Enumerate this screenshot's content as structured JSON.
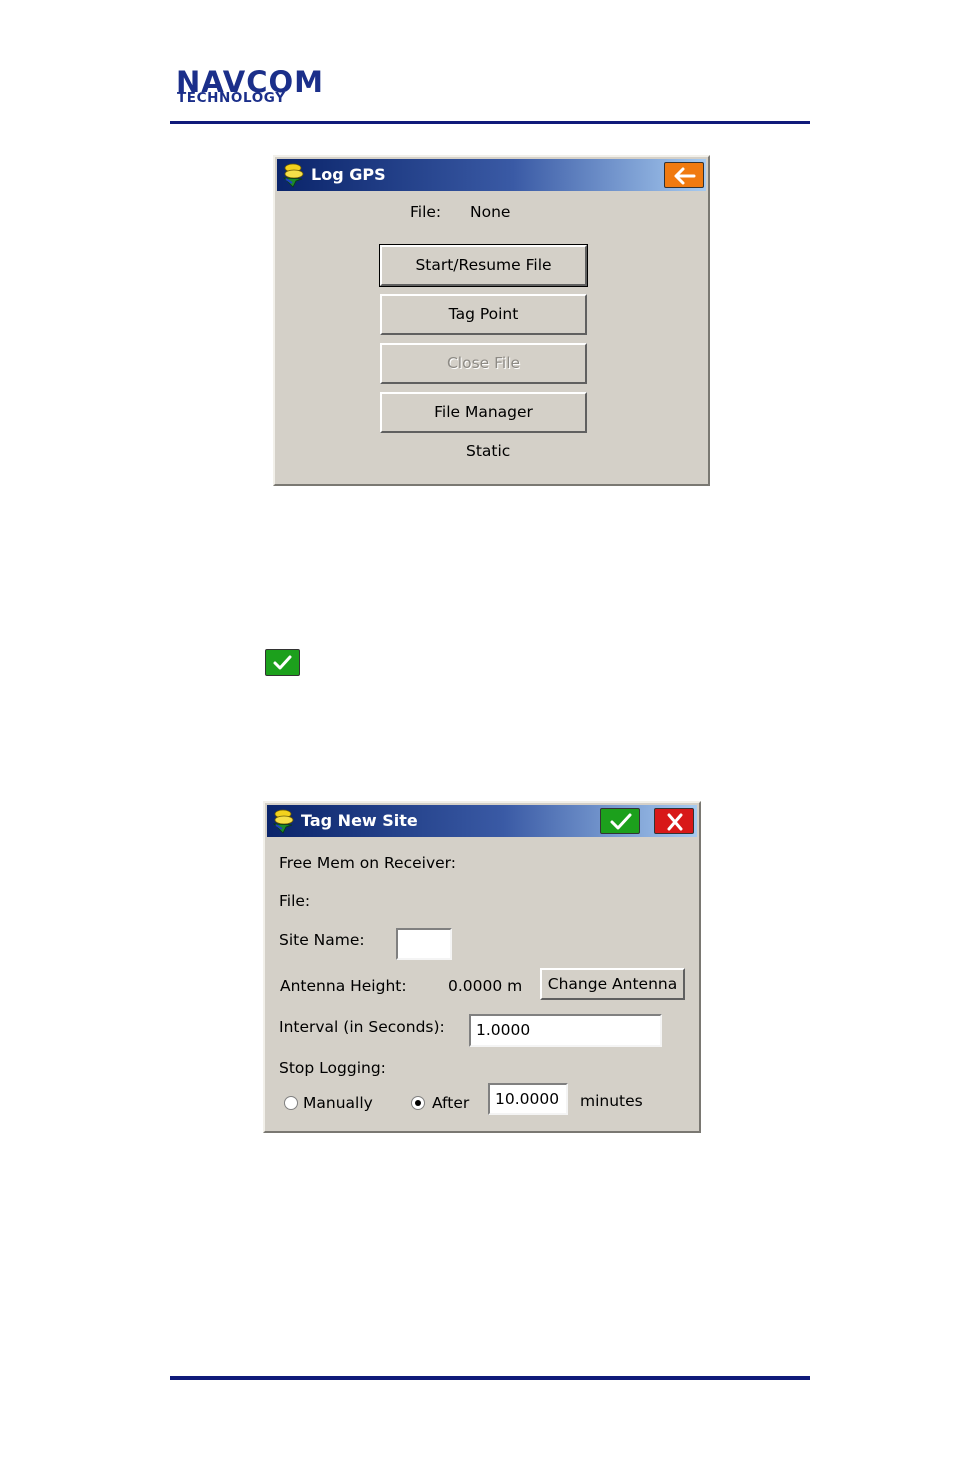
{
  "header": {
    "logo_line1": "NAVCOM",
    "logo_line2": "TECHNOLOGY",
    "brand_color": "#1b2f8a"
  },
  "log_gps": {
    "title": "Log GPS",
    "back_icon": "left-arrow-icon",
    "file_label": "File:",
    "file_value": "None",
    "buttons": {
      "start_resume": "Start/Resume File",
      "tag_point": "Tag Point",
      "close_file": "Close File",
      "file_manager": "File Manager"
    },
    "mode": "Static"
  },
  "inline_icon": "checkmark-icon",
  "tag_new_site": {
    "title": "Tag New Site",
    "ok_icon": "checkmark-icon",
    "cancel_icon": "close-icon",
    "free_mem_label": "Free Mem on Receiver:",
    "file_label": "File:",
    "site_name_label": "Site Name:",
    "site_name_value": "",
    "antenna_height_label": "Antenna Height:",
    "antenna_height_value": "0.0000 m",
    "change_antenna_label": "Change Antenna",
    "interval_label": "Interval (in Seconds):",
    "interval_value": "1.0000",
    "stop_logging_label": "Stop Logging:",
    "manually_label": "Manually",
    "after_label": "After",
    "after_value": "10.0000",
    "minutes_label": "minutes",
    "selected_option": "After"
  },
  "colors": {
    "dialog_bg": "#d4d0c8",
    "title_start": "#0a246a",
    "title_end": "#a6caf0",
    "ok_green": "#1ca01c",
    "cancel_red": "#d81818",
    "back_orange": "#f07a10",
    "rule_blue": "#101a7a"
  }
}
